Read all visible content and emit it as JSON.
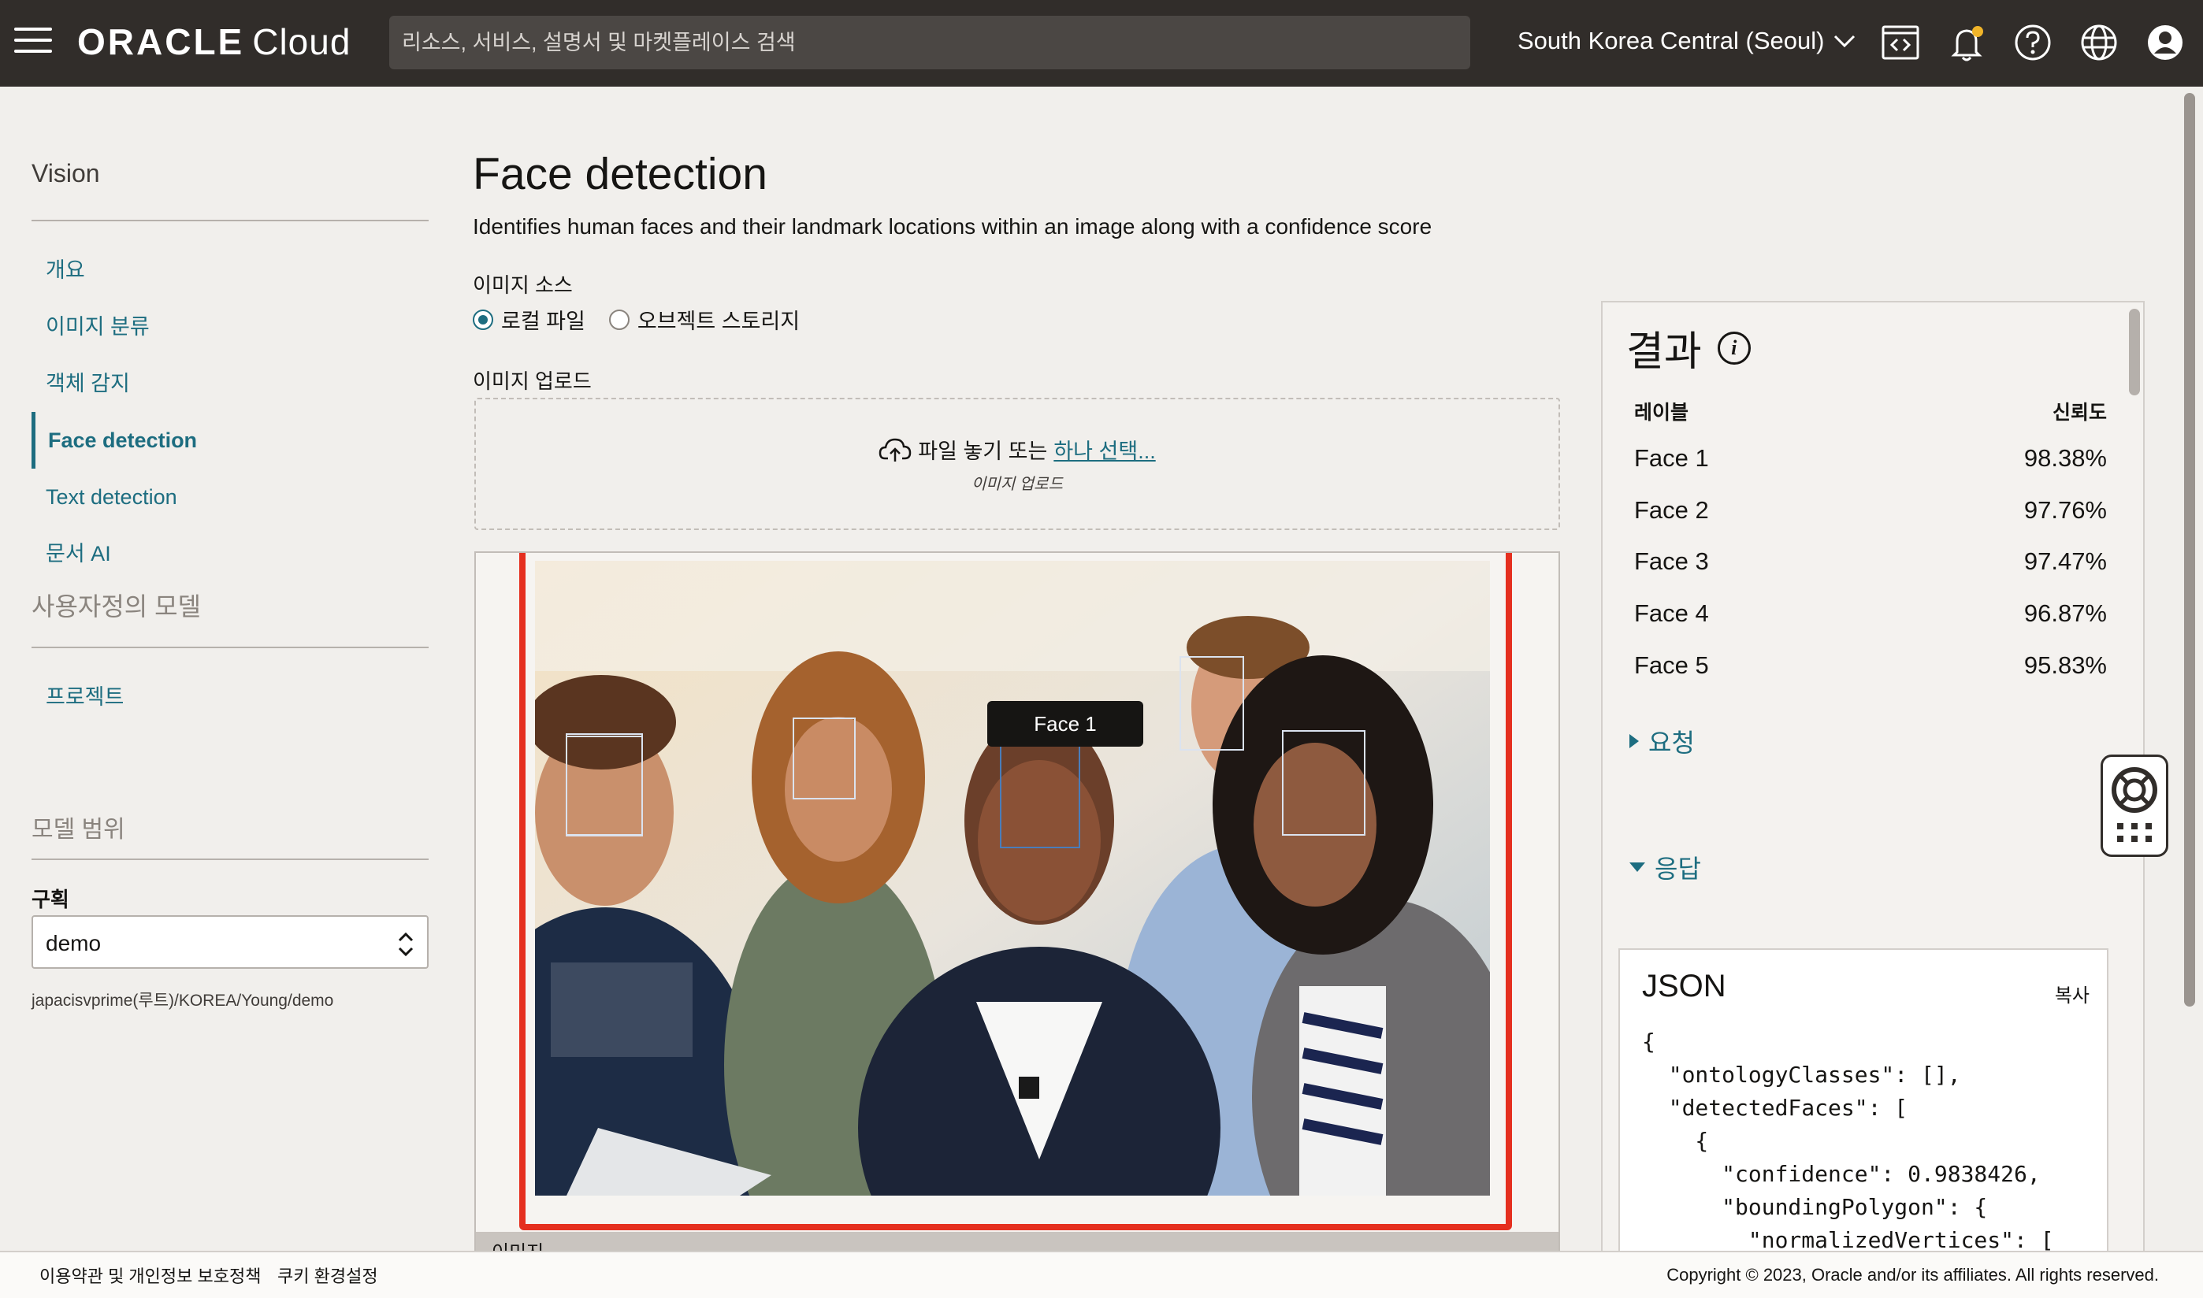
{
  "header": {
    "brand_bold": "ORACLE",
    "brand_light": "Cloud",
    "search_placeholder": "리소스, 서비스, 설명서 및 마켓플레이스 검색",
    "region": "South Korea Central (Seoul)"
  },
  "sidebar": {
    "title": "Vision",
    "items": [
      {
        "label": "개요"
      },
      {
        "label": "이미지 분류"
      },
      {
        "label": "객체 감지"
      },
      {
        "label": "Face detection",
        "active": true
      },
      {
        "label": "Text detection"
      },
      {
        "label": "문서 AI"
      }
    ],
    "custom_section": "사용자정의 모델",
    "custom_items": [
      {
        "label": "프로젝트"
      }
    ],
    "filter_title": "모델 범위",
    "compartment_label": "구획",
    "compartment_value": "demo",
    "compartment_path": "japacisvprime(루트)/KOREA/Young/demo"
  },
  "main": {
    "title": "Face detection",
    "description": "Identifies human faces and their landmark locations within an image along with a confidence score",
    "image_source_label": "이미지 소스",
    "radio_local": "로컬 파일",
    "radio_object": "오브젝트 스토리지",
    "upload_label": "이미지 업로드",
    "drop_text": "파일 놓기 또는",
    "drop_link": "하나 선택...",
    "drop_sub": "이미지 업로드",
    "image_footer": "이미지",
    "tooltip": "Face 1"
  },
  "results": {
    "title": "결과",
    "col_label": "레이블",
    "col_confidence": "신뢰도",
    "rows": [
      {
        "label": "Face 1",
        "confidence": "98.38%"
      },
      {
        "label": "Face 2",
        "confidence": "97.76%"
      },
      {
        "label": "Face 3",
        "confidence": "97.47%"
      },
      {
        "label": "Face 4",
        "confidence": "96.87%"
      },
      {
        "label": "Face 5",
        "confidence": "95.83%"
      }
    ],
    "request_label": "요청",
    "response_label": "응답",
    "json_title": "JSON",
    "copy_label": "복사",
    "json_lines": [
      "{",
      "  \"ontologyClasses\": [],",
      "  \"detectedFaces\": [",
      "    {",
      "      \"confidence\": 0.9838426,",
      "      \"boundingPolygon\": {",
      "        \"normalizedVertices\": ["
    ]
  },
  "footer": {
    "terms": "이용약관 및 개인정보 보호정책",
    "cookies": "쿠키 환경설정",
    "copyright": "Copyright © 2023, Oracle and/or its affiliates. All rights reserved."
  },
  "colors": {
    "topbar": "#312d2a",
    "accent": "#1d6d80",
    "highlight_border": "#e52f1f"
  },
  "icons": [
    "hamburger-icon",
    "code-editor-icon",
    "bell-icon",
    "help-icon",
    "globe-icon",
    "user-avatar-icon",
    "upload-cloud-icon",
    "info-icon",
    "lifebuoy-icon",
    "apps-grid-icon"
  ]
}
